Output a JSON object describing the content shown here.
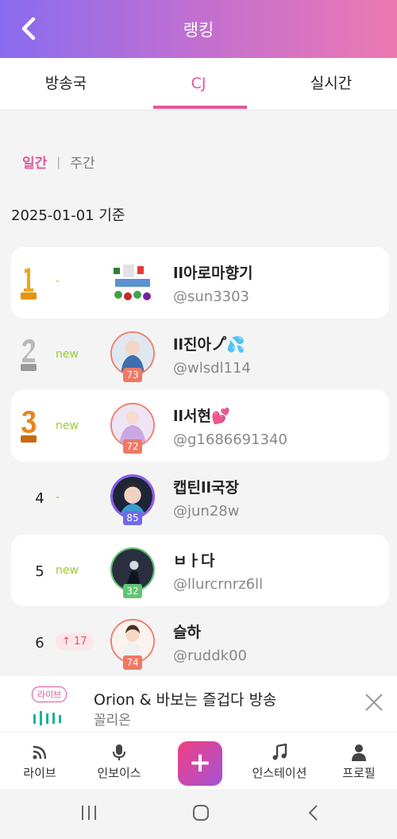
{
  "header": {
    "title": "랭킹"
  },
  "tabs": [
    {
      "label": "방송국",
      "active": false
    },
    {
      "label": "CJ",
      "active": true
    },
    {
      "label": "실시간",
      "active": false
    }
  ],
  "period": {
    "daily": "일간",
    "separator": "|",
    "weekly": "주간"
  },
  "basis": "2025-01-01 기준",
  "ranking": [
    {
      "rank": "1",
      "change": "-",
      "name": "ll아로마향기",
      "handle": "@sun3303",
      "level": ""
    },
    {
      "rank": "2",
      "change": "new",
      "name": "ll진아ノ゚💦",
      "handle": "@wlsdl114",
      "level": "73"
    },
    {
      "rank": "3",
      "change": "new",
      "name": "ll서현💕",
      "handle": "@g1686691340",
      "level": "72"
    },
    {
      "rank": "4",
      "change": "-",
      "name": "캡틴ll국장",
      "handle": "@jun28w",
      "level": "85"
    },
    {
      "rank": "5",
      "change": "new",
      "name": "ㅂㅏ다",
      "handle": "@llurcrnrz6ll",
      "level": "32"
    },
    {
      "rank": "6",
      "change": "17",
      "name": "슬하",
      "handle": "@ruddk00",
      "level": "74"
    }
  ],
  "player": {
    "badge": "라이브",
    "title": "Orion & 바보는 즐겁다 방송",
    "subtitle": "꼴리온"
  },
  "nav": [
    {
      "label": "라이브",
      "icon": "live-broadcast-icon"
    },
    {
      "label": "인보이스",
      "icon": "microphone-icon"
    },
    {
      "label": "+",
      "icon": "add-icon"
    },
    {
      "label": "인스테이션",
      "icon": "music-note-icon"
    },
    {
      "label": "프로필",
      "icon": "person-icon"
    }
  ],
  "colors": {
    "accent": "#e0589c",
    "gold": "#f2a51a",
    "silver": "#b8b8b8",
    "bronze": "#e8861c",
    "new": "#9acb33"
  }
}
